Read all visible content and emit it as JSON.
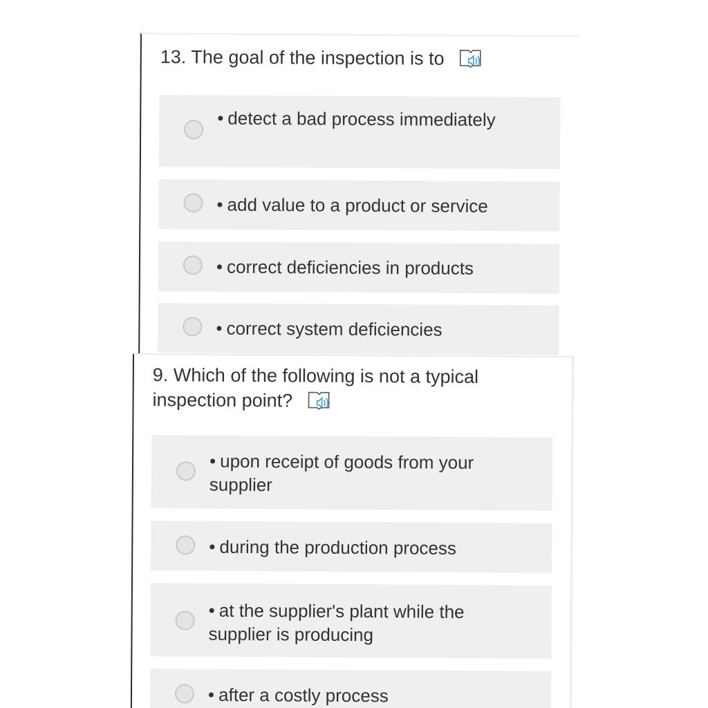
{
  "questions": [
    {
      "number": "13.",
      "text": "The goal of the inspection is to",
      "audio_icon": "speaker-book-icon",
      "options": [
        {
          "bullet": "•",
          "text": "detect a bad process immediately"
        },
        {
          "bullet": "•",
          "text": "add value to a product or service"
        },
        {
          "bullet": "•",
          "text": "correct deficiencies in products"
        },
        {
          "bullet": "•",
          "text": "correct system deficiencies"
        }
      ]
    },
    {
      "number": "9.",
      "text": "Which of the following is not a typical inspection point?",
      "audio_icon": "speaker-book-icon",
      "options": [
        {
          "bullet": "•",
          "text": "upon receipt of goods from your supplier"
        },
        {
          "bullet": "•",
          "text": "during the production process"
        },
        {
          "bullet": "•",
          "text": "at the supplier's plant while the supplier is producing"
        },
        {
          "bullet": "•",
          "text": "after a costly process"
        }
      ]
    }
  ],
  "colors": {
    "option_background": "#efefef",
    "text": "#333333",
    "icon_accent": "#3aa0dc"
  }
}
